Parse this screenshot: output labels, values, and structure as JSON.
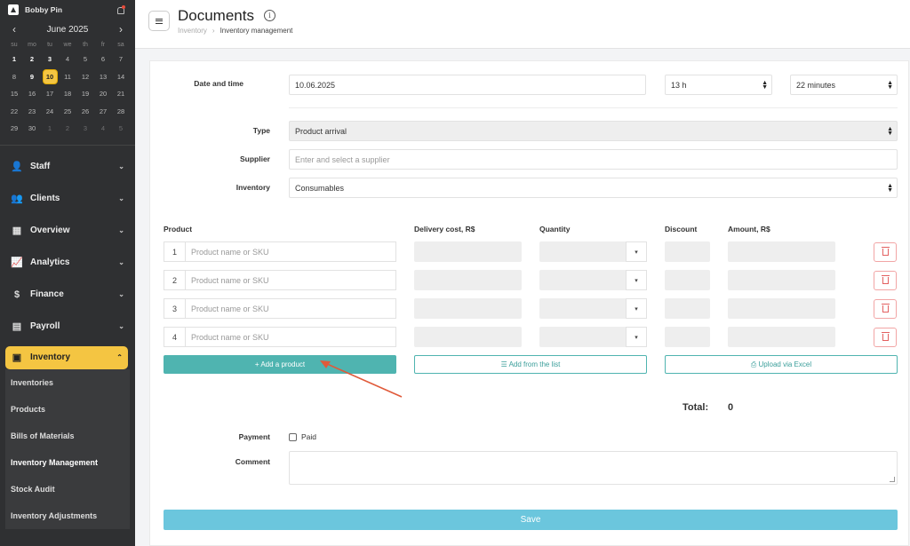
{
  "sidebar": {
    "user": "Bobby Pin",
    "calendar": {
      "month": "June 2025",
      "prev": "‹",
      "next": "›",
      "weekdays": [
        "su",
        "mo",
        "tu",
        "we",
        "th",
        "fr",
        "sa"
      ],
      "days": [
        {
          "d": "1",
          "s": "bold"
        },
        {
          "d": "2",
          "s": "bold"
        },
        {
          "d": "3",
          "s": "bold"
        },
        {
          "d": "4",
          "s": ""
        },
        {
          "d": "5",
          "s": ""
        },
        {
          "d": "6",
          "s": ""
        },
        {
          "d": "7",
          "s": ""
        },
        {
          "d": "8",
          "s": ""
        },
        {
          "d": "9",
          "s": "bold"
        },
        {
          "d": "10",
          "s": "today"
        },
        {
          "d": "11",
          "s": ""
        },
        {
          "d": "12",
          "s": ""
        },
        {
          "d": "13",
          "s": ""
        },
        {
          "d": "14",
          "s": ""
        },
        {
          "d": "15",
          "s": ""
        },
        {
          "d": "16",
          "s": ""
        },
        {
          "d": "17",
          "s": ""
        },
        {
          "d": "18",
          "s": ""
        },
        {
          "d": "19",
          "s": ""
        },
        {
          "d": "20",
          "s": ""
        },
        {
          "d": "21",
          "s": ""
        },
        {
          "d": "22",
          "s": ""
        },
        {
          "d": "23",
          "s": ""
        },
        {
          "d": "24",
          "s": ""
        },
        {
          "d": "25",
          "s": ""
        },
        {
          "d": "26",
          "s": ""
        },
        {
          "d": "27",
          "s": ""
        },
        {
          "d": "28",
          "s": ""
        },
        {
          "d": "29",
          "s": ""
        },
        {
          "d": "30",
          "s": ""
        },
        {
          "d": "1",
          "s": "muted"
        },
        {
          "d": "2",
          "s": "muted"
        },
        {
          "d": "3",
          "s": "muted"
        },
        {
          "d": "4",
          "s": "muted"
        },
        {
          "d": "5",
          "s": "muted"
        }
      ]
    },
    "menu": [
      {
        "label": "Staff",
        "icon": "user-icon",
        "glyph": "👤"
      },
      {
        "label": "Clients",
        "icon": "users-icon",
        "glyph": "👥"
      },
      {
        "label": "Overview",
        "icon": "grid-icon",
        "glyph": "▦"
      },
      {
        "label": "Analytics",
        "icon": "chart-line-icon",
        "glyph": "📈"
      },
      {
        "label": "Finance",
        "icon": "dollar-icon",
        "glyph": "$"
      },
      {
        "label": "Payroll",
        "icon": "calculator-icon",
        "glyph": "▤"
      }
    ],
    "active_menu": {
      "label": "Inventory",
      "icon": "boxes-icon",
      "glyph": "▣"
    },
    "submenu": [
      "Inventories",
      "Products",
      "Bills of Materials",
      "Inventory Management",
      "Stock Audit",
      "Inventory Adjustments"
    ],
    "submenu_current": 3
  },
  "header": {
    "title": "Documents",
    "info": "i",
    "crumbs": [
      "Inventory",
      "Inventory management"
    ],
    "crumb_sep": "›"
  },
  "form": {
    "date_label": "Date and time",
    "date_value": "10.06.2025",
    "hour_value": "13 h",
    "minute_value": "22 minutes",
    "type_label": "Type",
    "type_value": "Product arrival",
    "supplier_label": "Supplier",
    "supplier_placeholder": "Enter and select a supplier",
    "inventory_label": "Inventory",
    "inventory_value": "Consumables",
    "columns": {
      "product": "Product",
      "delivery": "Delivery cost, R$",
      "quantity": "Quantity",
      "discount": "Discount",
      "amount": "Amount, R$"
    },
    "rows": [
      {
        "n": "1",
        "placeholder": "Product name or SKU"
      },
      {
        "n": "2",
        "placeholder": "Product name or SKU"
      },
      {
        "n": "3",
        "placeholder": "Product name or SKU"
      },
      {
        "n": "4",
        "placeholder": "Product name or SKU"
      }
    ],
    "add_product": "+ Add a product",
    "add_from_list": "☰ Add from the list",
    "upload_excel": "⎙ Upload via Excel",
    "total_label": "Total:",
    "total_value": "0",
    "payment_label": "Payment",
    "paid_label": "Paid",
    "comment_label": "Comment",
    "save": "Save"
  },
  "colors": {
    "accent": "#f4c542",
    "teal": "#4fb4b0",
    "save": "#6bc6dd",
    "danger": "#e36060",
    "annotation": "#e05a3a"
  }
}
